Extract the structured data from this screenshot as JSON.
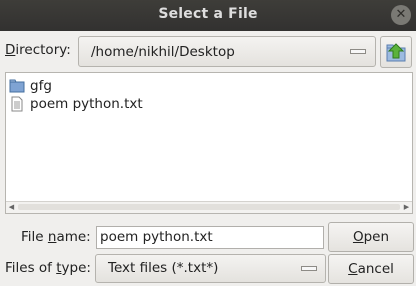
{
  "window": {
    "title": "Select a File",
    "close_glyph": "✕"
  },
  "directory": {
    "label_pre": "",
    "label_u": "D",
    "label_post": "irectory:",
    "path": "/home/nikhil/Desktop"
  },
  "files": [
    {
      "name": "gfg",
      "icon": "folder-icon"
    },
    {
      "name": "poem python.txt",
      "icon": "text-file-icon"
    }
  ],
  "scroll_arrows": {
    "left": "◀",
    "right": "▶"
  },
  "filename": {
    "label_pre": "File ",
    "label_u": "n",
    "label_post": "ame:",
    "value": "poem python.txt"
  },
  "filetype": {
    "label_pre": "Files of ",
    "label_u": "t",
    "label_post": "ype:",
    "value": "Text files (*.txt*)"
  },
  "buttons": {
    "open": {
      "u": "O",
      "rest": "pen"
    },
    "cancel": {
      "u": "C",
      "rest": "ancel"
    }
  },
  "colors": {
    "titlebar": "#3a3935",
    "folder": "#5a86c2",
    "up_arrow": "#5bb23c"
  }
}
